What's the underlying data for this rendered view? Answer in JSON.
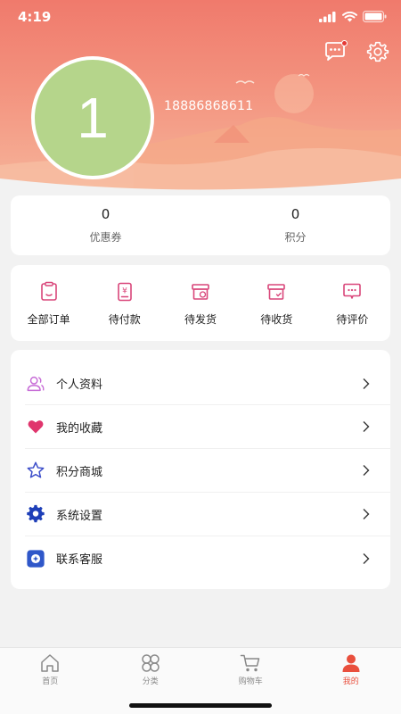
{
  "status_bar": {
    "time": "4:19"
  },
  "profile": {
    "avatar_text": "1",
    "phone": "18886868611"
  },
  "stats": [
    {
      "value": "0",
      "label": "优惠券"
    },
    {
      "value": "0",
      "label": "积分"
    }
  ],
  "orders": [
    {
      "label": "全部订单",
      "icon": "order-list-icon"
    },
    {
      "label": "待付款",
      "icon": "payment-icon"
    },
    {
      "label": "待发货",
      "icon": "shipping-box-icon"
    },
    {
      "label": "待收货",
      "icon": "receive-box-icon"
    },
    {
      "label": "待评价",
      "icon": "review-chat-icon"
    }
  ],
  "menu": [
    {
      "label": "个人资料",
      "icon": "user-profile-icon"
    },
    {
      "label": "我的收藏",
      "icon": "heart-icon"
    },
    {
      "label": "积分商城",
      "icon": "star-icon"
    },
    {
      "label": "系统设置",
      "icon": "gear-icon"
    },
    {
      "label": "联系客服",
      "icon": "customer-service-icon"
    }
  ],
  "tabs": [
    {
      "label": "首页",
      "icon": "home-icon",
      "active": false
    },
    {
      "label": "分类",
      "icon": "category-icon",
      "active": false
    },
    {
      "label": "购物车",
      "icon": "cart-icon",
      "active": false
    },
    {
      "label": "我的",
      "icon": "user-icon",
      "active": true
    }
  ],
  "colors": {
    "accent": "#e94f3d",
    "header_top": "#f07a6c",
    "avatar_bg": "#b5d58b",
    "icon_pink": "#d9467a"
  }
}
